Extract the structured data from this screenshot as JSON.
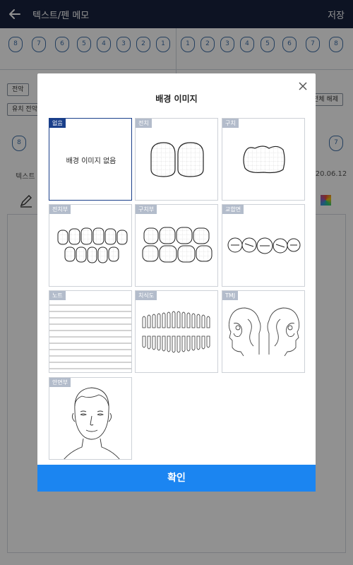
{
  "header": {
    "title": "텍스트/펜 메모",
    "save_label": "저장"
  },
  "background": {
    "upper_right_teeth": [
      "8",
      "7",
      "6",
      "5",
      "4",
      "3",
      "2",
      "1"
    ],
    "upper_left_teeth": [
      "1",
      "2",
      "3",
      "4",
      "5",
      "6",
      "7",
      "8"
    ],
    "lower_partial_teeth": [
      "8",
      "7"
    ],
    "chip_full": "전악",
    "chip_primary": "유치 전악",
    "chip_clear_all": "전체 해제",
    "text_label": "텍스트",
    "date": "2020.06.12"
  },
  "modal": {
    "title": "배경 이미지",
    "confirm_label": "확인",
    "options": [
      {
        "tag": "없음",
        "caption": "배경 이미지 없음",
        "selected": true
      },
      {
        "tag": "전치",
        "selected": false
      },
      {
        "tag": "구치",
        "selected": false
      },
      {
        "tag": "전치부",
        "selected": false
      },
      {
        "tag": "구치부",
        "selected": false
      },
      {
        "tag": "교합면",
        "selected": false
      },
      {
        "tag": "노트",
        "selected": false
      },
      {
        "tag": "치식도",
        "selected": false
      },
      {
        "tag": "TMJ",
        "selected": false
      },
      {
        "tag": "안면부",
        "selected": false
      }
    ]
  },
  "colors": {
    "header_bg": "#17223f",
    "accent": "#1b85f1",
    "selected_border": "#1a3f8a",
    "tooth_outline": "#3f6fa8"
  }
}
